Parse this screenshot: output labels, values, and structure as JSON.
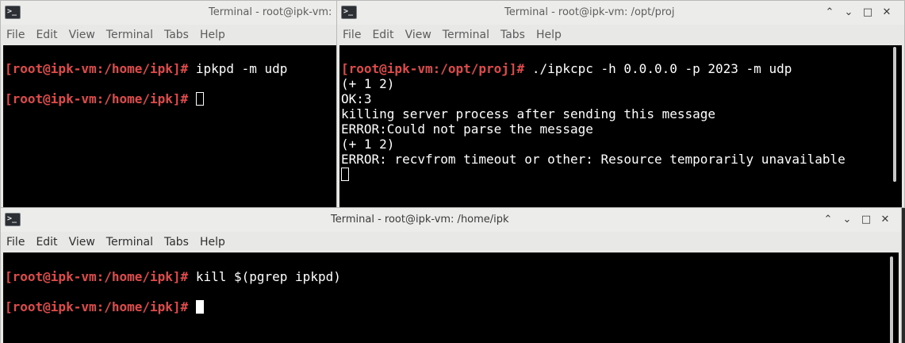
{
  "menu": [
    "File",
    "Edit",
    "View",
    "Terminal",
    "Tabs",
    "Help"
  ],
  "icon_glyph": ">_",
  "window_buttons": {
    "minimize": "⌃",
    "restore": "⌄",
    "maximize": "□",
    "close": "✕"
  },
  "win1": {
    "title": "Terminal - root@ipk-vm: /home/ipk",
    "title_visible": "Terminal - root@ipk-vm:",
    "lines": [
      {
        "prompt": "[root@ipk-vm:/home/ipk]#",
        "cmd": " ipkpd -m udp"
      },
      {
        "prompt": "[root@ipk-vm:/home/ipk]#",
        "cmd": " "
      }
    ]
  },
  "win2": {
    "title": "Terminal - root@ipk-vm: /opt/proj",
    "prompt": "[root@ipk-vm:/opt/proj]#",
    "cmd": " ./ipkcpc -h 0.0.0.0 -p 2023 -m udp",
    "output": [
      "(+ 1 2)",
      "OK:3",
      "killing server process after sending this message",
      "ERROR:Could not parse the message",
      "(+ 1 2)",
      "ERROR: recvfrom timeout or other: Resource temporarily unavailable"
    ]
  },
  "win3": {
    "title": "Terminal - root@ipk-vm: /home/ipk",
    "lines": [
      {
        "prompt": "[root@ipk-vm:/home/ipk]#",
        "cmd": " kill $(pgrep ipkpd)"
      },
      {
        "prompt": "[root@ipk-vm:/home/ipk]#",
        "cmd": " "
      }
    ]
  },
  "colors": {
    "prompt": "#e04a4a",
    "terminal_bg": "#000000",
    "terminal_fg": "#ffffff"
  }
}
